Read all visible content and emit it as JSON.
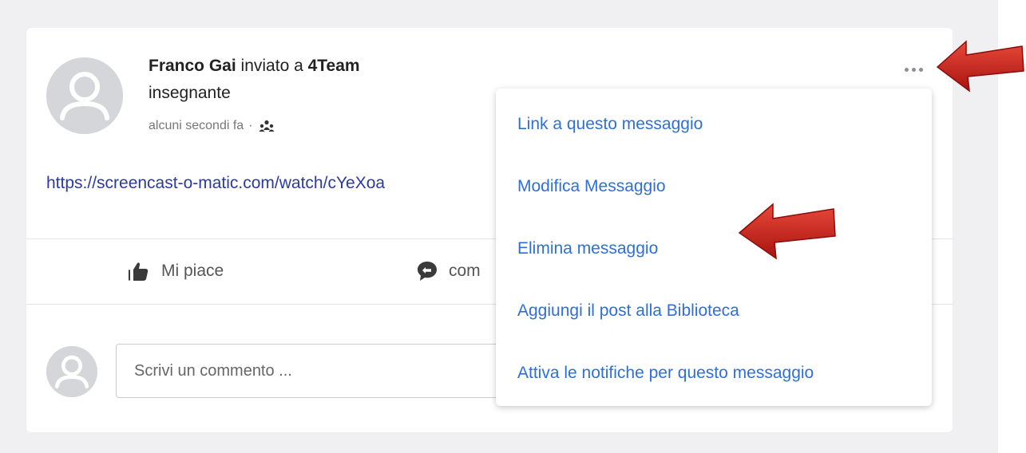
{
  "post": {
    "author": "Franco Gai",
    "sent_to_text": "inviato a",
    "group": "4Team",
    "role": "insegnante",
    "timestamp": "alcuni secondi fa",
    "separator": "·",
    "link_text": "https://screencast-o-matic.com/watch/cYeXoa"
  },
  "actions": {
    "like_label": "Mi piace",
    "comment_label": "com"
  },
  "comment_box": {
    "placeholder": "Scrivi un commento ..."
  },
  "menu": {
    "items": [
      {
        "label": "Link a questo messaggio"
      },
      {
        "label": "Modifica Messaggio"
      },
      {
        "label": "Elimina messaggio"
      },
      {
        "label": "Aggiungi il post alla Biblioteca"
      },
      {
        "label": "Attiva le notifiche per questo messaggio"
      }
    ]
  },
  "icons": {
    "more": "more-horizontal-icon",
    "like": "thumbs-up-icon",
    "comment": "speech-bubble-icon",
    "group": "group-icon",
    "avatar": "user-avatar-icon",
    "annotation": "red-arrow-icon"
  },
  "colors": {
    "link": "#2c3b9d",
    "menu_link": "#2f6fd9",
    "arrow": "#c8201e",
    "avatar": "#d5d6da"
  }
}
